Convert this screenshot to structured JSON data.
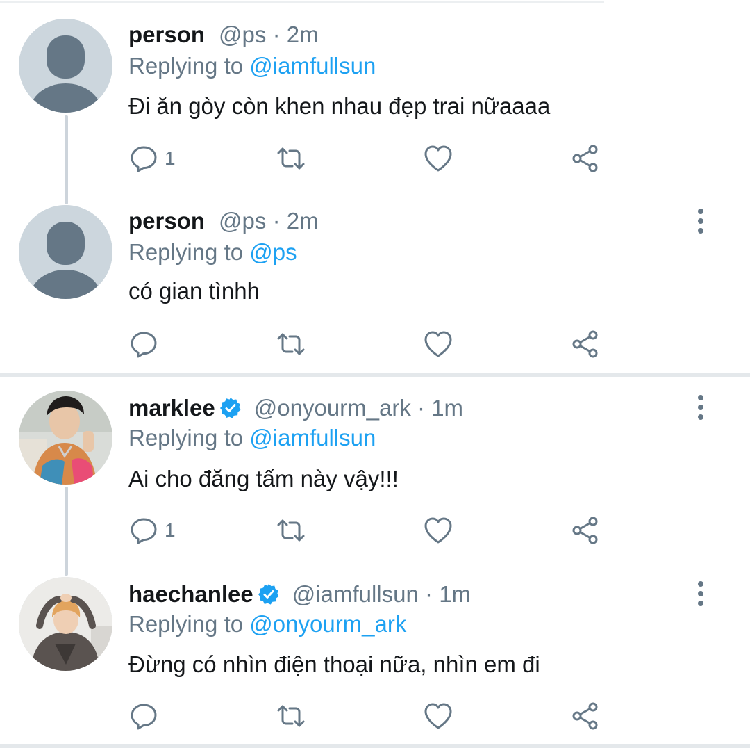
{
  "tweets": [
    {
      "name": "person",
      "handle": "@ps",
      "dot": "·",
      "time": "2m",
      "reply_prefix": "Replying to",
      "reply_to": "@iamfullsun",
      "text": "Đi ăn gòy còn khen nhau đẹp trai nữaaaa",
      "reply_count": "1",
      "verified": false,
      "avatar": "default-avatar"
    },
    {
      "name": "person",
      "handle": "@ps",
      "dot": "·",
      "time": "2m",
      "reply_prefix": "Replying to",
      "reply_to": "@ps",
      "text": "có gian tìnhh",
      "reply_count": "",
      "verified": false,
      "avatar": "default-avatar"
    },
    {
      "name": "marklee",
      "handle": "@onyourm_ark",
      "dot": "·",
      "time": "1m",
      "reply_prefix": "Replying to",
      "reply_to": "@iamfullsun",
      "text": "Ai cho đăng tấm này vậy!!!",
      "reply_count": "1",
      "verified": true,
      "avatar": "photo-avatar"
    },
    {
      "name": "haechanlee",
      "handle": "@iamfullsun",
      "dot": "·",
      "time": "1m",
      "reply_prefix": "Replying to",
      "reply_to": "@onyourm_ark",
      "text": "Đừng có nhìn điện thoại nữa, nhìn em đi",
      "reply_count": "",
      "verified": true,
      "avatar": "photo-avatar"
    }
  ],
  "icons": {
    "reply": "speech-bubble-icon",
    "retweet": "retweet-icon",
    "like": "heart-icon",
    "share": "share-icon",
    "more": "vertical-dots-icon",
    "verified": "verified-badge-icon"
  },
  "colors": {
    "accent": "#1da1f2",
    "secondary_text": "#657786",
    "icon": "#657786",
    "avatar_bg": "#ccd6dd",
    "avatar_fg": "#657786"
  }
}
